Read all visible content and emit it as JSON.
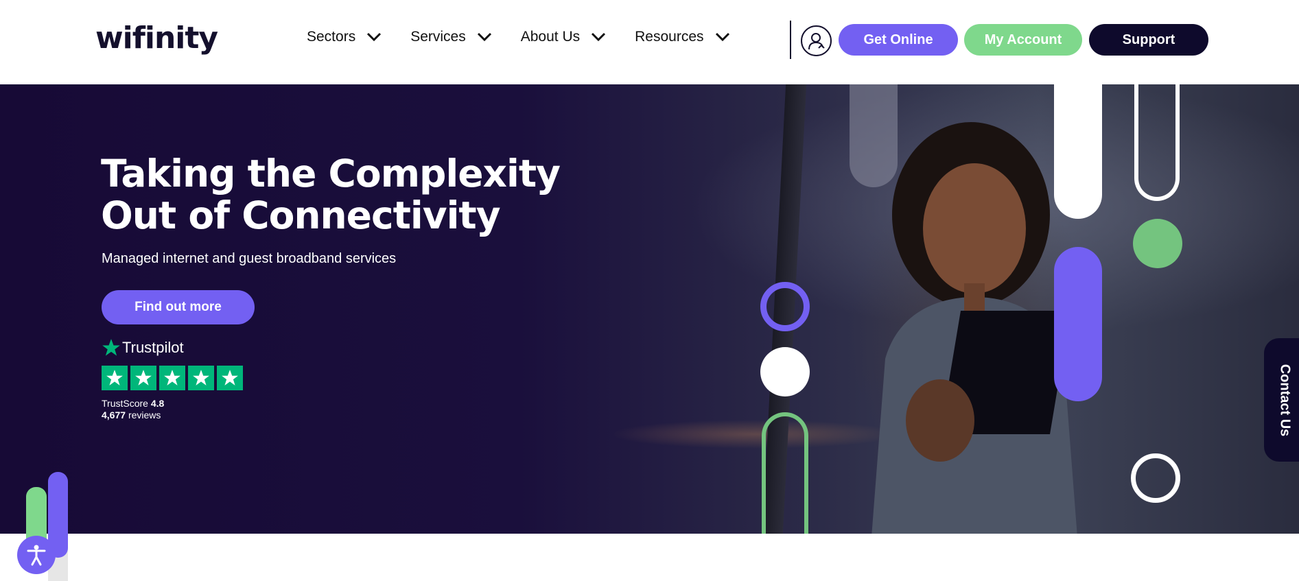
{
  "header": {
    "logo_text": "wifinity",
    "nav": [
      {
        "label": "Sectors"
      },
      {
        "label": "Services"
      },
      {
        "label": "About Us"
      },
      {
        "label": "Resources"
      }
    ],
    "buttons": {
      "get_online": "Get Online",
      "my_account": "My Account",
      "support": "Support"
    }
  },
  "hero": {
    "title": "Taking the Complexity Out of Connectivity",
    "subtitle": "Managed internet and guest broadband services",
    "cta": "Find out more",
    "trustpilot": {
      "brand": "Trustpilot",
      "score_label": "TrustScore",
      "score": "4.8",
      "reviews_count": "4,677",
      "reviews_label": "reviews",
      "stars": 5
    }
  },
  "contact_tab": "Contact Us",
  "colors": {
    "brand_purple": "#7360f2",
    "brand_green": "#7fd88c",
    "brand_navy": "#0e0a2c",
    "trustpilot_green": "#00b67a"
  },
  "icons": [
    "chevron-down-icon",
    "account-icon",
    "star-icon",
    "accessibility-icon"
  ]
}
